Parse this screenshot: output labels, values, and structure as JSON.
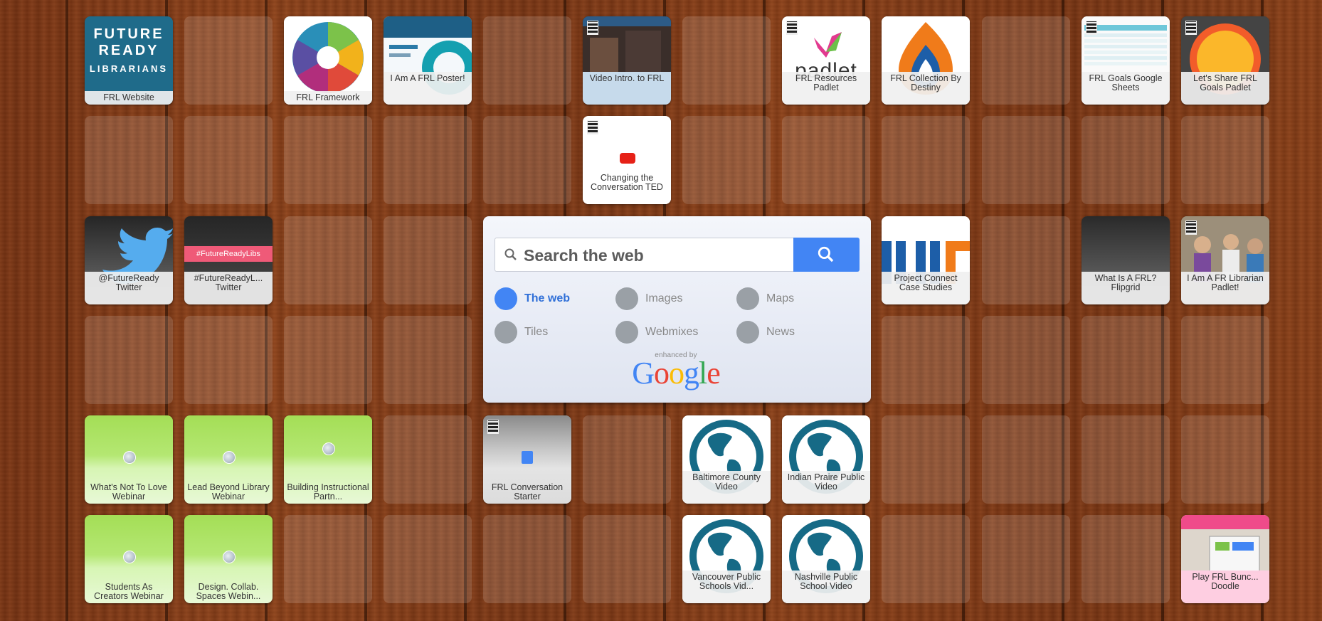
{
  "board": {
    "background": "wood-planks",
    "accent": "#4285f4"
  },
  "tiles": {
    "frl_website": {
      "label": "FRL Website",
      "logo_lines": [
        "FUTURE",
        "READY",
        "LIBRARIANS"
      ]
    },
    "frl_framework": {
      "label": "FRL Framework"
    },
    "frl_poster": {
      "label": "I Am A FRL Poster!"
    },
    "video_intro": {
      "label": "Video Intro. to FRL"
    },
    "resources_padlet": {
      "label": "FRL Resources Padlet",
      "logo_text": "padlet"
    },
    "collection_destiny": {
      "label": "FRL Collection By Destiny"
    },
    "goals_sheets": {
      "label": "FRL Goals Google Sheets"
    },
    "goals_padlet": {
      "label": "Let's Share FRL Goals Padlet"
    },
    "changing_conversation": {
      "label": "Changing the Conversation TED"
    },
    "twitter": {
      "label": "@FutureReady Twitter"
    },
    "hashtag": {
      "label": "#FutureReadyL... Twitter",
      "banner": "#FutureReadyLibs"
    },
    "project_connect": {
      "label": "Project Connect Case Studies"
    },
    "flipgrid": {
      "label": "What Is A FRL? Flipgrid"
    },
    "librarian_padlet": {
      "label": "I Am A FR Librarian Padlet!"
    },
    "whats_not_to_love": {
      "label": "What's Not To Love Webinar"
    },
    "lead_beyond": {
      "label": "Lead Beyond Library Webinar"
    },
    "building_instructional": {
      "label": "Building Instructional Partn..."
    },
    "conversation_starter": {
      "label": "FRL Conversation Starter"
    },
    "baltimore": {
      "label": "Baltimore County Video"
    },
    "indian_praire": {
      "label": "Indian Praire Public Video"
    },
    "students_creators": {
      "label": "Students As Creators Webinar"
    },
    "design_collab": {
      "label": "Design. Collab. Spaces Webin..."
    },
    "vancouver": {
      "label": "Vancouver Public Schools Vid..."
    },
    "nashville": {
      "label": "Nashville Public School Video"
    },
    "play_doodle": {
      "label": "Play FRL Bunc... Doodle"
    }
  },
  "search": {
    "placeholder": "Search the web",
    "options": [
      {
        "label": "The web",
        "icon": "search-icon",
        "active": true
      },
      {
        "label": "Images",
        "icon": "camera-icon",
        "active": false
      },
      {
        "label": "Maps",
        "icon": "map-pin-icon",
        "active": false
      },
      {
        "label": "Tiles",
        "icon": "link-icon",
        "active": false
      },
      {
        "label": "Webmixes",
        "icon": "webmix-icon",
        "active": false
      },
      {
        "label": "News",
        "icon": "news-icon",
        "active": false
      }
    ],
    "enhanced_by": "enhanced by",
    "google": "Google"
  }
}
